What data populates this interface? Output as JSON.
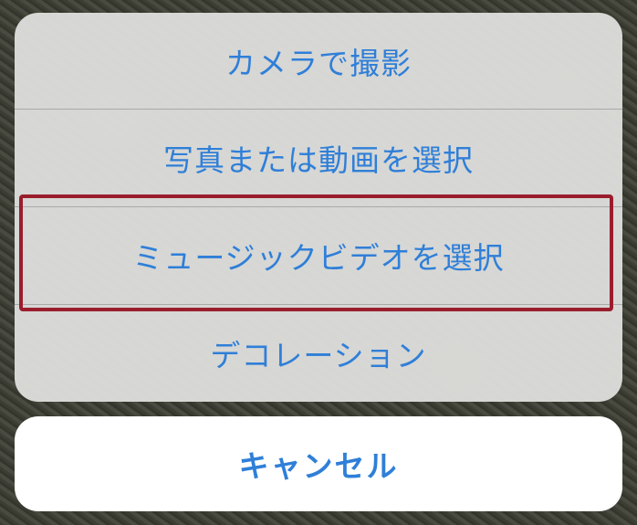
{
  "action_sheet": {
    "items": [
      {
        "label": "カメラで撮影"
      },
      {
        "label": "写真または動画を選択"
      },
      {
        "label": "ミュージックビデオを選択"
      },
      {
        "label": "デコレーション"
      }
    ],
    "highlighted_index": 2
  },
  "cancel_label": "キャンセル",
  "colors": {
    "accent": "#2f7fd8",
    "highlight_border": "#9a1d2c",
    "sheet_background": "#dcdcda",
    "cancel_background": "#ffffff"
  }
}
